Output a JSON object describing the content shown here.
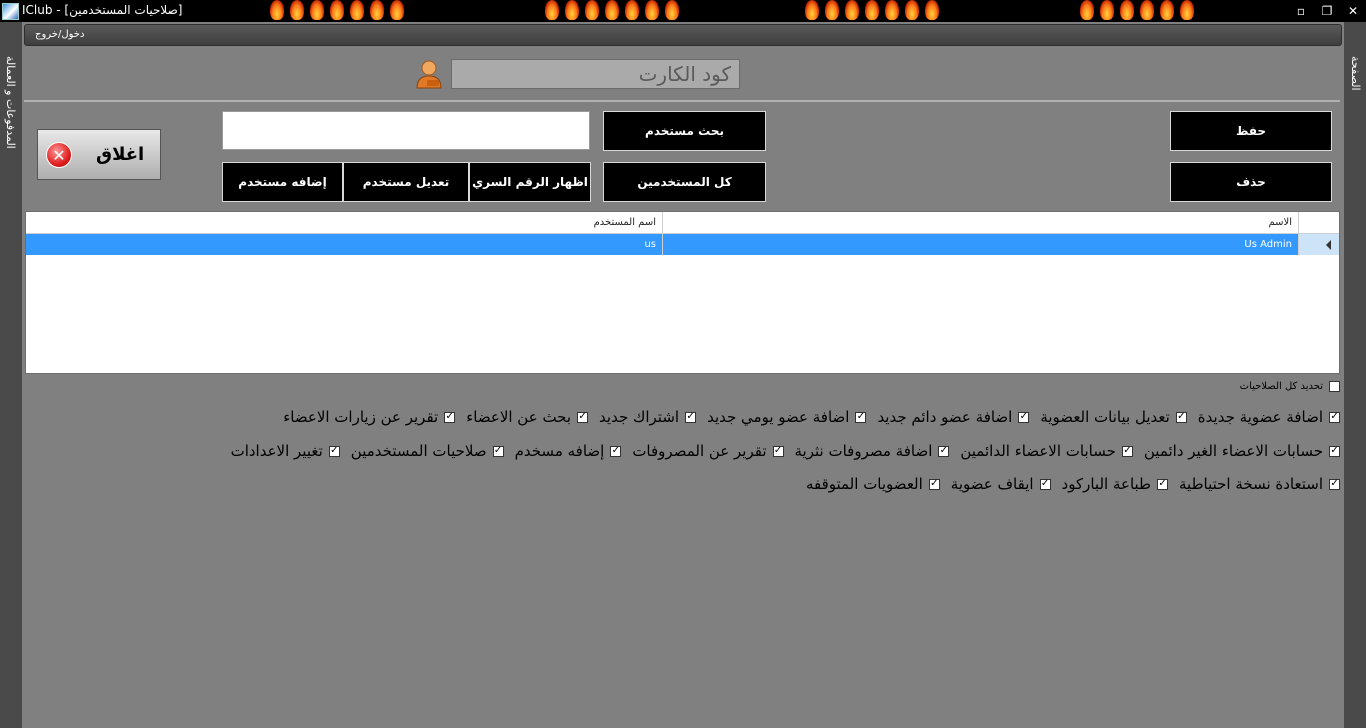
{
  "window": {
    "title": "IClub - [صلاحيات المستخدمين]",
    "controls": [
      "▫",
      "❐",
      "✕"
    ]
  },
  "sidebar_left": {
    "label": "المدفوعات و العمالة"
  },
  "sidebar_right": {
    "label": "الصفحة"
  },
  "menu": {
    "login_logout": "دخول/خروج"
  },
  "card": {
    "placeholder": "كود الكارت"
  },
  "buttons": {
    "save": "حفظ",
    "delete": "حذف",
    "search_user": "بحث مستخدم",
    "all_users": "كل المستخدمين",
    "show_password": "اظهار الرقم السري",
    "edit_user": "تعديل مستخدم",
    "add_user": "إضافه مستخدم",
    "close": "اغلاق"
  },
  "search": {
    "value": ""
  },
  "grid": {
    "headers": {
      "name": "الاسم",
      "username": "اسم المستخدم"
    },
    "rows": [
      {
        "name": "Us Admin",
        "username": "us"
      }
    ]
  },
  "permissions": {
    "select_all": "تحديد كل الصلاحيات",
    "rows": [
      [
        "اضافة عضوية جديدة",
        "تعديل بيانات العضوية",
        "اضافة عضو دائم جديد",
        "اضافة عضو يومي جديد",
        "اشتراك جديد",
        "بحث عن الاعضاء",
        "تقرير عن زيارات الاعضاء"
      ],
      [
        "حسابات الاعضاء الغير دائمين",
        "حسابات الاعضاء الدائمين",
        "اضافة مصروفات نثرية",
        "تقرير عن المصروفات",
        "إضافه مسخدم",
        "صلاحيات المستخدمين",
        "تغيير الاعدادات"
      ],
      [
        "استعادة نسخة احتياطية",
        "طباعة الباركود",
        "ايقاف عضوية",
        "العضويات المتوقفه"
      ]
    ]
  },
  "colors": {
    "background": "#808080",
    "selected_row": "#3399ff",
    "button_black": "#000000"
  }
}
